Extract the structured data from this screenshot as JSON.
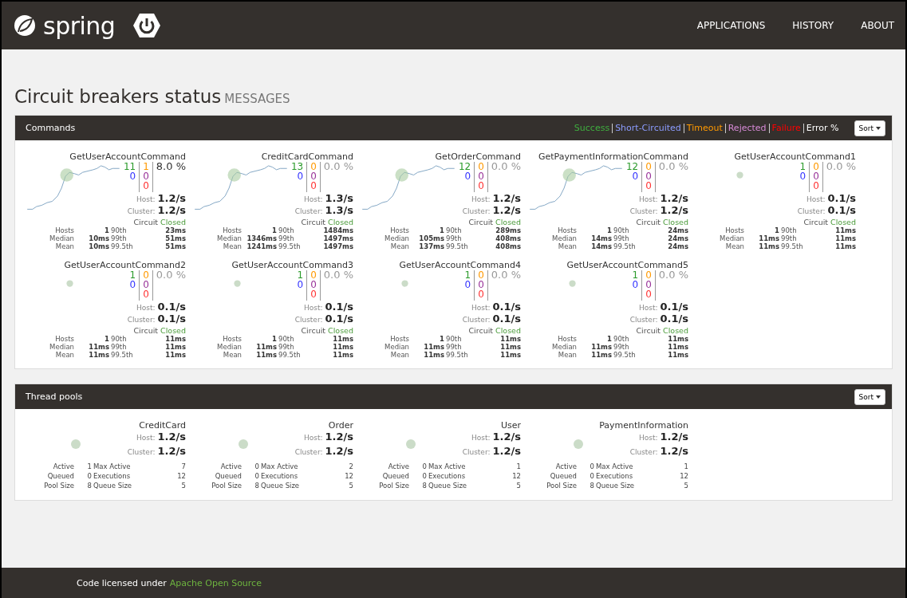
{
  "header": {
    "logo": "spring",
    "nav": [
      {
        "label": "APPLICATIONS",
        "selected": false
      },
      {
        "label": "HISTORY",
        "selected": false
      },
      {
        "label": "ABOUT",
        "selected": false
      }
    ]
  },
  "page": {
    "title": "Circuit breakers status",
    "subtitle": "MESSAGES"
  },
  "commands_panel": {
    "title": "Commands",
    "sort": "Sort",
    "legend": [
      {
        "label": "Success",
        "color": "#3fae3f"
      },
      {
        "label": "Short-Circuited",
        "color": "#8c9cff"
      },
      {
        "label": "Timeout",
        "color": "#ff9900"
      },
      {
        "label": "Rejected",
        "color": "#d68ad6"
      },
      {
        "label": "Failure",
        "color": "#ff0000"
      },
      {
        "label": "Error %",
        "color": "#ffffff"
      }
    ],
    "commands": [
      {
        "name": "GetUserAccountCommand",
        "trend": true,
        "success": "11",
        "short_circuited": "0",
        "timeout": "1",
        "rejected": "0",
        "failure": "0",
        "error": "8.0 %",
        "error_alert": true,
        "rates": [
          {
            "label": "Host:",
            "value": "1.2/s"
          },
          {
            "label": "Cluster:",
            "value": "1.2/s"
          }
        ],
        "circuit": {
          "label": "Circuit",
          "state": "Closed",
          "open": false
        },
        "stats": [
          [
            "Hosts",
            "1",
            "90th",
            "23ms"
          ],
          [
            "Median",
            "10ms",
            "99th",
            "51ms"
          ],
          [
            "Mean",
            "10ms",
            "99.5th",
            "51ms"
          ]
        ]
      },
      {
        "name": "CreditCardCommand",
        "trend": true,
        "success": "13",
        "short_circuited": "0",
        "timeout": "0",
        "rejected": "0",
        "failure": "0",
        "error": "0.0 %",
        "error_alert": false,
        "rates": [
          {
            "label": "Host:",
            "value": "1.3/s"
          },
          {
            "label": "Cluster:",
            "value": "1.3/s"
          }
        ],
        "circuit": {
          "label": "Circuit",
          "state": "Closed",
          "open": false
        },
        "stats": [
          [
            "Hosts",
            "1",
            "90th",
            "1484ms"
          ],
          [
            "Median",
            "1346ms",
            "99th",
            "1497ms"
          ],
          [
            "Mean",
            "1241ms",
            "99.5th",
            "1497ms"
          ]
        ]
      },
      {
        "name": "GetOrderCommand",
        "trend": true,
        "success": "12",
        "short_circuited": "0",
        "timeout": "0",
        "rejected": "0",
        "failure": "0",
        "error": "0.0 %",
        "error_alert": false,
        "rates": [
          {
            "label": "Host:",
            "value": "1.2/s"
          },
          {
            "label": "Cluster:",
            "value": "1.2/s"
          }
        ],
        "circuit": {
          "label": "Circuit",
          "state": "Closed",
          "open": false
        },
        "stats": [
          [
            "Hosts",
            "1",
            "90th",
            "289ms"
          ],
          [
            "Median",
            "105ms",
            "99th",
            "408ms"
          ],
          [
            "Mean",
            "137ms",
            "99.5th",
            "408ms"
          ]
        ]
      },
      {
        "name": "GetPaymentInformationCommand",
        "trend": true,
        "success": "12",
        "short_circuited": "0",
        "timeout": "0",
        "rejected": "0",
        "failure": "0",
        "error": "0.0 %",
        "error_alert": false,
        "rates": [
          {
            "label": "Host:",
            "value": "1.2/s"
          },
          {
            "label": "Cluster:",
            "value": "1.2/s"
          }
        ],
        "circuit": {
          "label": "Circuit",
          "state": "Closed",
          "open": false
        },
        "stats": [
          [
            "Hosts",
            "1",
            "90th",
            "24ms"
          ],
          [
            "Median",
            "14ms",
            "99th",
            "24ms"
          ],
          [
            "Mean",
            "14ms",
            "99.5th",
            "24ms"
          ]
        ]
      },
      {
        "name": "GetUserAccountCommand1",
        "trend": false,
        "success": "1",
        "short_circuited": "0",
        "timeout": "0",
        "rejected": "0",
        "failure": "0",
        "error": "0.0 %",
        "error_alert": false,
        "rates": [
          {
            "label": "Host:",
            "value": "0.1/s"
          },
          {
            "label": "Cluster:",
            "value": "0.1/s"
          }
        ],
        "circuit": {
          "label": "Circuit",
          "state": "Closed",
          "open": false
        },
        "stats": [
          [
            "Hosts",
            "1",
            "90th",
            "11ms"
          ],
          [
            "Median",
            "11ms",
            "99th",
            "11ms"
          ],
          [
            "Mean",
            "11ms",
            "99.5th",
            "11ms"
          ]
        ]
      },
      {
        "name": "GetUserAccountCommand2",
        "trend": false,
        "success": "1",
        "short_circuited": "0",
        "timeout": "0",
        "rejected": "0",
        "failure": "0",
        "error": "0.0 %",
        "error_alert": false,
        "rates": [
          {
            "label": "Host:",
            "value": "0.1/s"
          },
          {
            "label": "Cluster:",
            "value": "0.1/s"
          }
        ],
        "circuit": {
          "label": "Circuit",
          "state": "Closed",
          "open": false
        },
        "stats": [
          [
            "Hosts",
            "1",
            "90th",
            "11ms"
          ],
          [
            "Median",
            "11ms",
            "99th",
            "11ms"
          ],
          [
            "Mean",
            "11ms",
            "99.5th",
            "11ms"
          ]
        ]
      },
      {
        "name": "GetUserAccountCommand3",
        "trend": false,
        "success": "1",
        "short_circuited": "0",
        "timeout": "0",
        "rejected": "0",
        "failure": "0",
        "error": "0.0 %",
        "error_alert": false,
        "rates": [
          {
            "label": "Host:",
            "value": "0.1/s"
          },
          {
            "label": "Cluster:",
            "value": "0.1/s"
          }
        ],
        "circuit": {
          "label": "Circuit",
          "state": "Closed",
          "open": false
        },
        "stats": [
          [
            "Hosts",
            "1",
            "90th",
            "11ms"
          ],
          [
            "Median",
            "11ms",
            "99th",
            "11ms"
          ],
          [
            "Mean",
            "11ms",
            "99.5th",
            "11ms"
          ]
        ]
      },
      {
        "name": "GetUserAccountCommand4",
        "trend": false,
        "success": "1",
        "short_circuited": "0",
        "timeout": "0",
        "rejected": "0",
        "failure": "0",
        "error": "0.0 %",
        "error_alert": false,
        "rates": [
          {
            "label": "Host:",
            "value": "0.1/s"
          },
          {
            "label": "Cluster:",
            "value": "0.1/s"
          }
        ],
        "circuit": {
          "label": "Circuit",
          "state": "Closed",
          "open": false
        },
        "stats": [
          [
            "Hosts",
            "1",
            "90th",
            "11ms"
          ],
          [
            "Median",
            "11ms",
            "99th",
            "11ms"
          ],
          [
            "Mean",
            "11ms",
            "99.5th",
            "11ms"
          ]
        ]
      },
      {
        "name": "GetUserAccountCommand5",
        "trend": false,
        "success": "1",
        "short_circuited": "0",
        "timeout": "0",
        "rejected": "0",
        "failure": "0",
        "error": "0.0 %",
        "error_alert": false,
        "rates": [
          {
            "label": "Host:",
            "value": "0.1/s"
          },
          {
            "label": "Cluster:",
            "value": "0.1/s"
          }
        ],
        "circuit": {
          "label": "Circuit",
          "state": "Closed",
          "open": false
        },
        "stats": [
          [
            "Hosts",
            "1",
            "90th",
            "11ms"
          ],
          [
            "Median",
            "11ms",
            "99th",
            "11ms"
          ],
          [
            "Mean",
            "11ms",
            "99.5th",
            "11ms"
          ]
        ]
      }
    ]
  },
  "thread_pools_panel": {
    "title": "Thread pools",
    "sort": "Sort",
    "pools": [
      {
        "name": "CreditCard",
        "rates": [
          {
            "label": "Host:",
            "value": "1.2/s"
          },
          {
            "label": "Cluster:",
            "value": "1.2/s"
          }
        ],
        "stats": [
          [
            "Active",
            "1",
            "Max Active",
            "7"
          ],
          [
            "Queued",
            "0",
            "Executions",
            "12"
          ],
          [
            "Pool Size",
            "8",
            "Queue Size",
            "5"
          ]
        ]
      },
      {
        "name": "Order",
        "rates": [
          {
            "label": "Host:",
            "value": "1.2/s"
          },
          {
            "label": "Cluster:",
            "value": "1.2/s"
          }
        ],
        "stats": [
          [
            "Active",
            "0",
            "Max Active",
            "2"
          ],
          [
            "Queued",
            "0",
            "Executions",
            "12"
          ],
          [
            "Pool Size",
            "8",
            "Queue Size",
            "5"
          ]
        ]
      },
      {
        "name": "User",
        "rates": [
          {
            "label": "Host:",
            "value": "1.2/s"
          },
          {
            "label": "Cluster:",
            "value": "1.2/s"
          }
        ],
        "stats": [
          [
            "Active",
            "0",
            "Max Active",
            "1"
          ],
          [
            "Queued",
            "0",
            "Executions",
            "12"
          ],
          [
            "Pool Size",
            "8",
            "Queue Size",
            "5"
          ]
        ]
      },
      {
        "name": "PaymentInformation",
        "rates": [
          {
            "label": "Host:",
            "value": "1.2/s"
          },
          {
            "label": "Cluster:",
            "value": "1.2/s"
          }
        ],
        "stats": [
          [
            "Active",
            "0",
            "Max Active",
            "1"
          ],
          [
            "Queued",
            "0",
            "Executions",
            "12"
          ],
          [
            "Pool Size",
            "8",
            "Queue Size",
            "5"
          ]
        ]
      }
    ]
  },
  "footer": {
    "text": "Code licensed under",
    "link": "Apache Open Source"
  }
}
